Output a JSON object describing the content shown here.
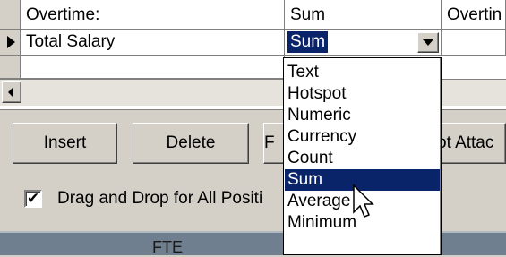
{
  "grid": {
    "rows": [
      {
        "field": "Overtime:",
        "aggregate": "Sum",
        "extra": "Overtin"
      },
      {
        "field": "Total Salary",
        "aggregate": "Sum",
        "extra": ""
      },
      {
        "field": "",
        "aggregate": "",
        "extra": ""
      }
    ]
  },
  "buttons": {
    "insert": "Insert",
    "delete": "Delete",
    "hidden": "F",
    "attach": "ot Attac"
  },
  "drag_drop": {
    "checked": true,
    "label": "Drag and Drop for All Positi"
  },
  "bottom_strip": {
    "label": "FTE"
  },
  "dropdown": {
    "selected": "Sum",
    "options": [
      "Text",
      "Hotspot",
      "Numeric",
      "Currency",
      "Count",
      "Sum",
      "Average",
      "Minimum"
    ]
  },
  "colors": {
    "selection": "#0a246a",
    "face": "#d4d0c8"
  },
  "icons": {
    "row_indicator": "right-triangle-icon",
    "dropdown": "chevron-down-icon",
    "scroll_left": "arrow-left-icon",
    "cursor": "mouse-pointer-icon"
  }
}
